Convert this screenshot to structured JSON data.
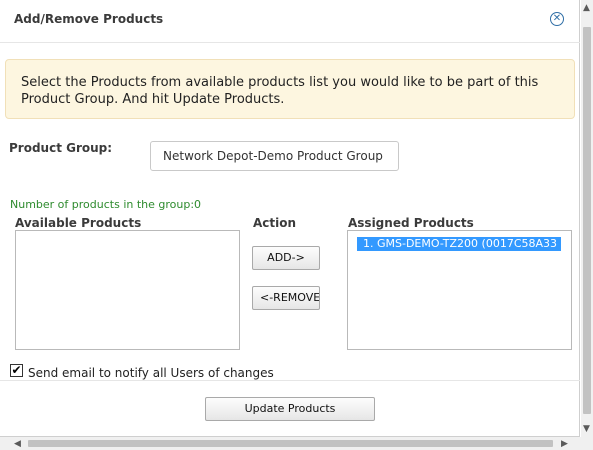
{
  "dialog": {
    "title": "Add/Remove Products",
    "close_icon": "close-circle-icon"
  },
  "notice": {
    "text": "Select the Products from available products list you would like to be part of this Product Group. And hit Update Products."
  },
  "product_group": {
    "label": "Product Group:",
    "value": "Network Depot-Demo Product Group"
  },
  "count_text": "Number of products in the group:0",
  "columns": {
    "available": "Available Products",
    "action": "Action",
    "assigned": "Assigned Products"
  },
  "available_products": [],
  "assigned_products": [
    {
      "label": "1. GMS-DEMO-TZ200 (0017C58A33",
      "selected": true
    }
  ],
  "buttons": {
    "add": "ADD->",
    "remove": "<-REMOVE",
    "update": "Update Products"
  },
  "notify": {
    "label": "Send email to notify all Users of changes",
    "checked": true,
    "check_glyph": "✔"
  },
  "scrollbars": {
    "up_icon": "▲",
    "down_icon": "▼",
    "left_icon": "◀",
    "right_icon": "▶"
  },
  "colors": {
    "notice_bg": "#fdf6e0",
    "selection": "#3399ff",
    "count_text": "#2e8b2e"
  }
}
